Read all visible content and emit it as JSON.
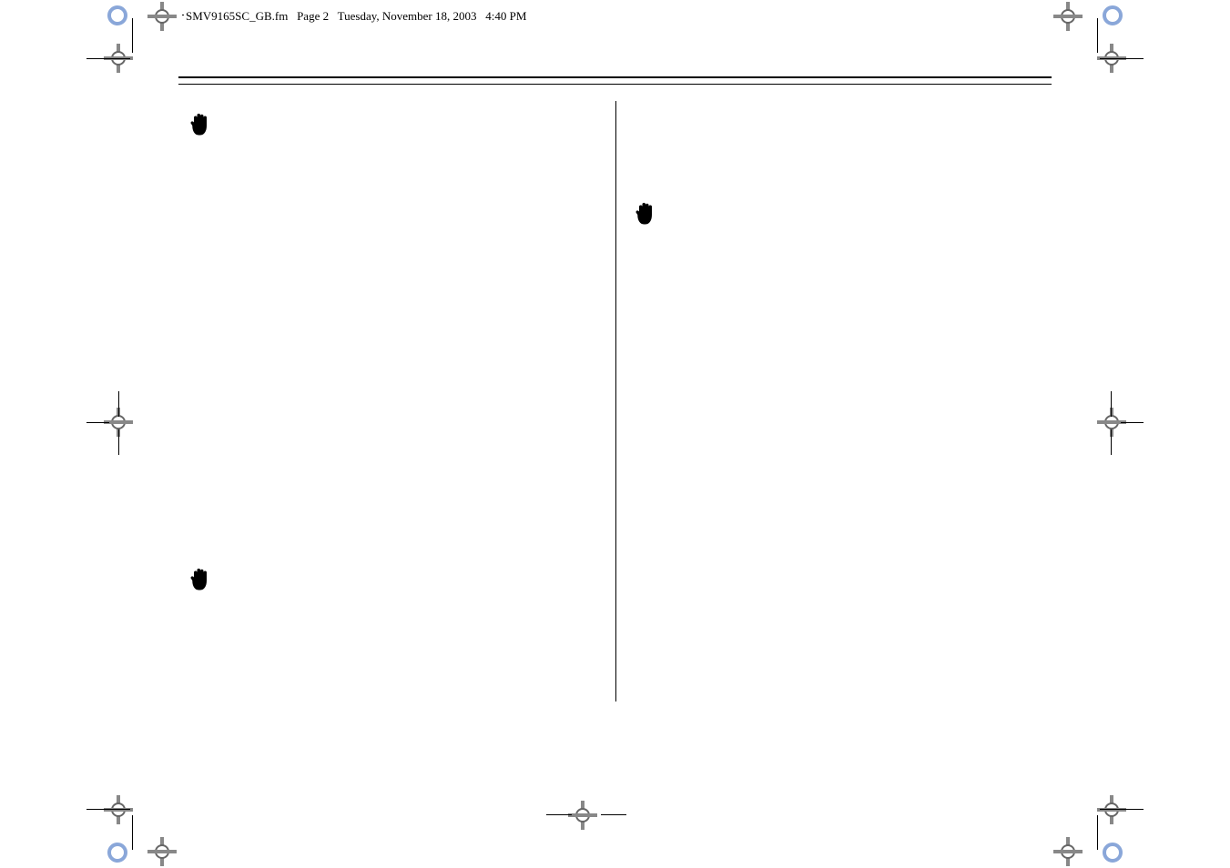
{
  "header": {
    "filename": "SMV9165SC_GB.fm",
    "page_label": "Page 2",
    "date_label": "Tuesday, November 18, 2003",
    "time_label": "4:40 PM"
  },
  "icons": {
    "hand": "hand-icon"
  }
}
